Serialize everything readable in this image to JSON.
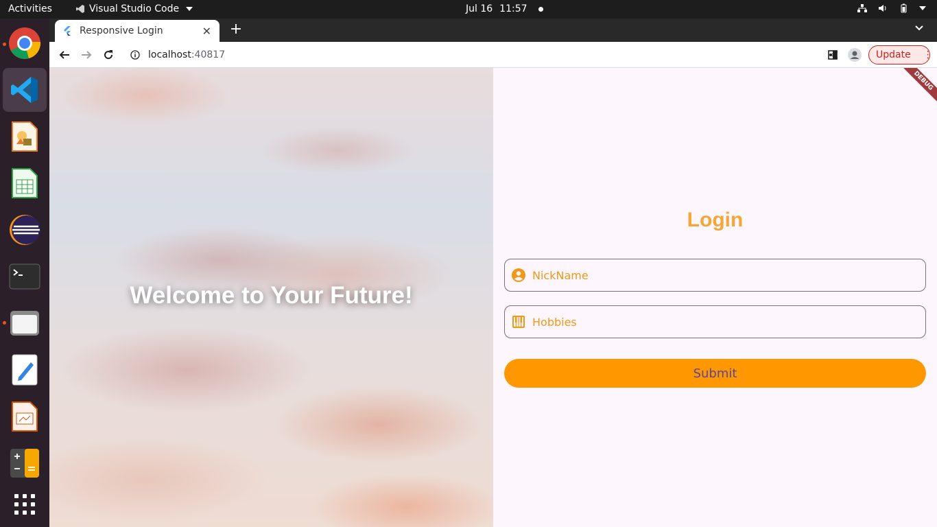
{
  "topbar": {
    "activities": "Activities",
    "app_name": "Visual Studio Code",
    "date": "Jul 16",
    "time": "11:57"
  },
  "dock": {
    "items": [
      "chrome-icon",
      "vscode-icon",
      "draw-icon",
      "spreadsheet-icon",
      "eclipse-icon",
      "terminal-icon",
      "files-icon",
      "text-editor-icon",
      "presentation-icon",
      "calculator-icon",
      "app-grid-icon"
    ]
  },
  "browser": {
    "tab_title": "Responsive Login",
    "url_host": "localhost",
    "url_port": ":40817",
    "update_label": "Update"
  },
  "page": {
    "hero_title": "Welcome to Your Future!",
    "debug_label": "DEBUG",
    "login_title": "Login",
    "nickname_placeholder": "NickName",
    "hobbies_placeholder": "Hobbies",
    "submit_label": "Submit"
  },
  "colors": {
    "accent": "#ff9800",
    "title": "#f5a638",
    "submit_text": "#5b4599"
  }
}
